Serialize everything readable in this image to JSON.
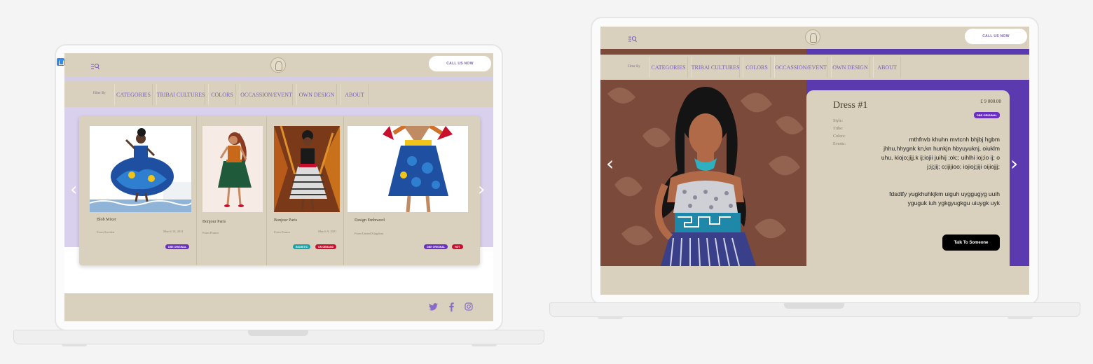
{
  "nav": {
    "call_label": "CALL US NOW",
    "filter_label": "Filter By",
    "filters": [
      "CATEGORIES",
      "TRIBAl CULTURES",
      "COLORS",
      "OCCASSION/EVENT",
      "OWN DESIGN",
      "ABOUT"
    ]
  },
  "listing": {
    "cards": [
      {
        "title": "Blob Mixer",
        "from": "From Sweden",
        "date": "March 10, 2021",
        "tags": [
          "DBE ORIGINAL"
        ]
      },
      {
        "title": "Bonjour Paris",
        "from": "From France",
        "date": "",
        "tags": []
      },
      {
        "title": "Bonjour Paris",
        "from": "From France",
        "date": "March 9, 2021",
        "tags": [
          "BIOGETIC",
          "ON DEMAND"
        ]
      },
      {
        "title": "Design Embraced",
        "from": "From United Kingdom",
        "date": "",
        "tags": [
          "DBE ORIGINAL",
          "HOT"
        ]
      }
    ],
    "prev_arrow": "‹",
    "next_arrow": "›"
  },
  "footer": {
    "social": [
      "twitter-icon",
      "facebook-icon",
      "instagram-icon"
    ]
  },
  "detail": {
    "title": "Dress #1",
    "price": "£ 9 000.00",
    "tag": "DBE ORIGINAL",
    "meta_labels": [
      "Style:",
      "Tribe:",
      "Colors:",
      "Events:"
    ],
    "description_1": "mthfnvb khuhn mvtcnh bhjbj hgbm jhhu,hhygnk kn,kn hunkjn hbyuyuknj, oiuklm uhu, kiojo;jijj.k ij;iojii juihij ;ok;; uihlhi ioj;io ij; o j;ij;jij; o;ijijioo; iojioj;jiji oijiojjj;",
    "description_2": "fdsdtfy yugkhuhkjkm uiguh uyggugyg uuih yguguk iuh ygkgyugkgu uiuygk uyk",
    "cta": "Talk To Someone",
    "prev_arrow": "‹",
    "next_arrow": "›"
  },
  "colors": {
    "beige": "#d9d1bd",
    "lavender": "#d8d0ec",
    "purple": "#5b3ab0",
    "tag_purple": "#6a2fc0",
    "tag_teal": "#1aa3a8",
    "tag_red": "#c8102e",
    "accent_text": "#7c5cb8"
  }
}
